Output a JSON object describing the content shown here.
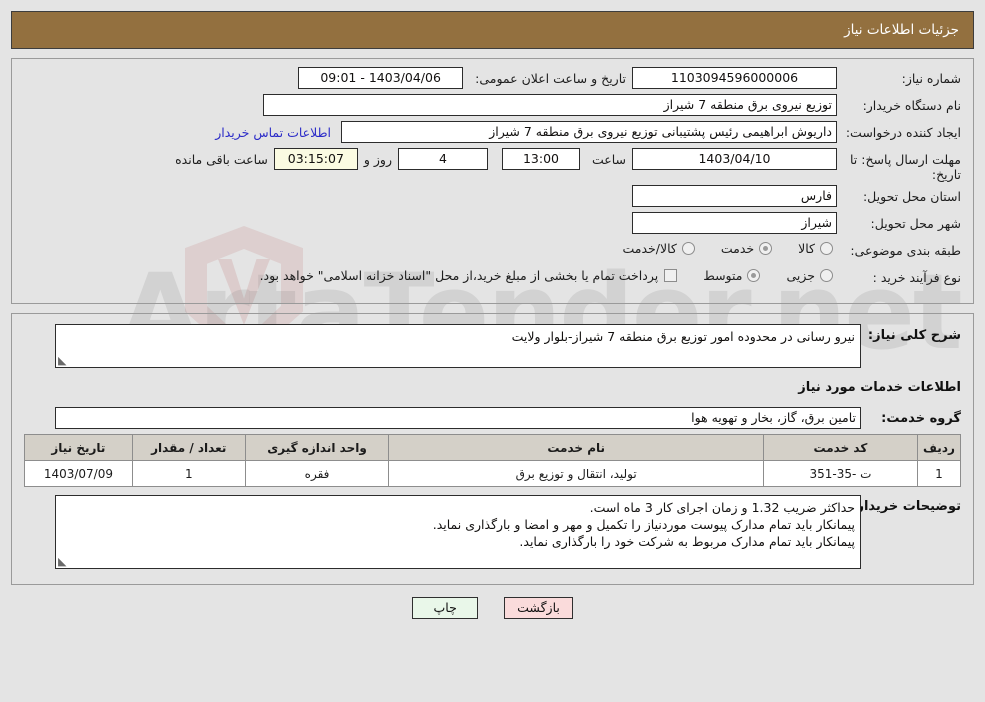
{
  "header": {
    "title": "جزئیات اطلاعات نیاز"
  },
  "colors": {
    "header_bg": "#93703f",
    "page_bg": "#e4e4e4",
    "link": "#2b2bc8",
    "countdown_bg": "#fbfbe2",
    "print_btn_bg": "#e9f7e9",
    "back_btn_bg": "#fadbdb",
    "table_header_bg": "#d4d0c8"
  },
  "watermark": {
    "text": "ArtaTender.net"
  },
  "form": {
    "need_number_label": "شماره نیاز:",
    "need_number_value": "1103094596000006",
    "announce_datetime_label": "تاریخ و ساعت اعلان عمومی:",
    "announce_datetime_value": "1403/04/06 - 09:01",
    "buyer_org_label": "نام دستگاه خریدار:",
    "buyer_org_value": "توزیع نیروی برق منطقه 7 شیراز",
    "creator_label": "ایجاد کننده درخواست:",
    "creator_value": "داریوش ابراهیمی رئیس پشتیبانی توزیع نیروی برق منطقه 7 شیراز",
    "contact_link": "اطلاعات تماس خریدار",
    "deadline_label": "مهلت ارسال پاسخ: تا تاریخ:",
    "deadline_date": "1403/04/10",
    "hour_label": "ساعت",
    "deadline_time": "13:00",
    "days_value": "4",
    "days_label": "روز و",
    "countdown_value": "03:15:07",
    "remaining_label": "ساعت باقی مانده",
    "province_label": "استان محل تحویل:",
    "province_value": "فارس",
    "city_label": "شهر محل تحویل:",
    "city_value": "شیراز",
    "category_label": "طبقه بندی موضوعی:",
    "category_options": [
      {
        "label": "کالا",
        "selected": false
      },
      {
        "label": "خدمت",
        "selected": true
      },
      {
        "label": "کالا/خدمت",
        "selected": false
      }
    ],
    "process_label": "نوع فرآیند خرید :",
    "process_options": [
      {
        "label": "جزیی",
        "selected": false
      },
      {
        "label": "متوسط",
        "selected": true
      }
    ],
    "treasury_checkbox_checked": false,
    "treasury_note": "پرداخت تمام یا بخشی از مبلغ خرید،از محل \"اسناد خزانه اسلامی\" خواهد بود."
  },
  "middle": {
    "summary_label": "شرح کلی نیاز:",
    "summary_value": "نیرو رسانی در محدوده امور توزیع برق منطقه 7 شیراز-بلوار ولایت",
    "services_heading": "اطلاعات خدمات مورد نیاز",
    "service_group_label": "گروه خدمت:",
    "service_group_value": "تامین برق، گاز، بخار و تهویه هوا"
  },
  "table": {
    "headers": [
      "ردیف",
      "کد خدمت",
      "نام خدمت",
      "واحد اندازه گیری",
      "تعداد / مقدار",
      "تاریخ نیاز"
    ],
    "rows": [
      {
        "row_no": "1",
        "service_code": "ت -35-351",
        "service_name": "تولید، انتقال و توزیع برق",
        "unit": "فقره",
        "quantity": "1",
        "need_date": "1403/07/09"
      }
    ]
  },
  "comments": {
    "label": "توضیحات خریدار:",
    "lines": [
      "حداکثر ضریب 1.32 و زمان اجرای کار 3 ماه است.",
      "پیمانکار باید تمام مدارک پیوست موردنیاز را تکمیل و مهر و امضا و بارگذاری نماید.",
      "پیمانکار باید تمام مدارک مربوط به شرکت خود را بارگذاری نماید."
    ]
  },
  "footer": {
    "print_label": "چاپ",
    "back_label": "بازگشت"
  }
}
